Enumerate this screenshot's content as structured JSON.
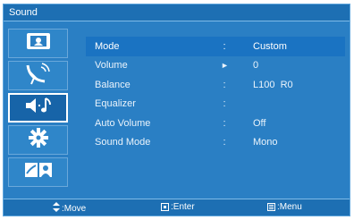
{
  "window": {
    "title": "Sound"
  },
  "sidebar": {
    "items": [
      {
        "icon": "picture-icon",
        "active": false
      },
      {
        "icon": "satellite-dish-icon",
        "active": false
      },
      {
        "icon": "sound-icon",
        "active": true
      },
      {
        "icon": "gear-icon",
        "active": false
      },
      {
        "icon": "input-source-icon",
        "active": false
      }
    ]
  },
  "menu": {
    "rows": [
      {
        "label": "Mode",
        "sep": ":",
        "value": "Custom",
        "selected": true
      },
      {
        "label": "Volume",
        "sep": "►",
        "value": "0",
        "selected": false
      },
      {
        "label": "Balance",
        "sep": ":",
        "value": "L100  R0",
        "selected": false
      },
      {
        "label": "Equalizer",
        "sep": ":",
        "value": "",
        "selected": false
      },
      {
        "label": "Auto Volume",
        "sep": ":",
        "value": "Off",
        "selected": false
      },
      {
        "label": "Sound Mode",
        "sep": ":",
        "value": "Mono",
        "selected": false
      }
    ]
  },
  "footer": {
    "move_label": ":Move",
    "enter_label": ":Enter",
    "menu_label": ":Menu"
  },
  "colors": {
    "background": "#2a7fc4",
    "selected_row": "#1a73c2",
    "active_sidebar": "#1764a8"
  }
}
